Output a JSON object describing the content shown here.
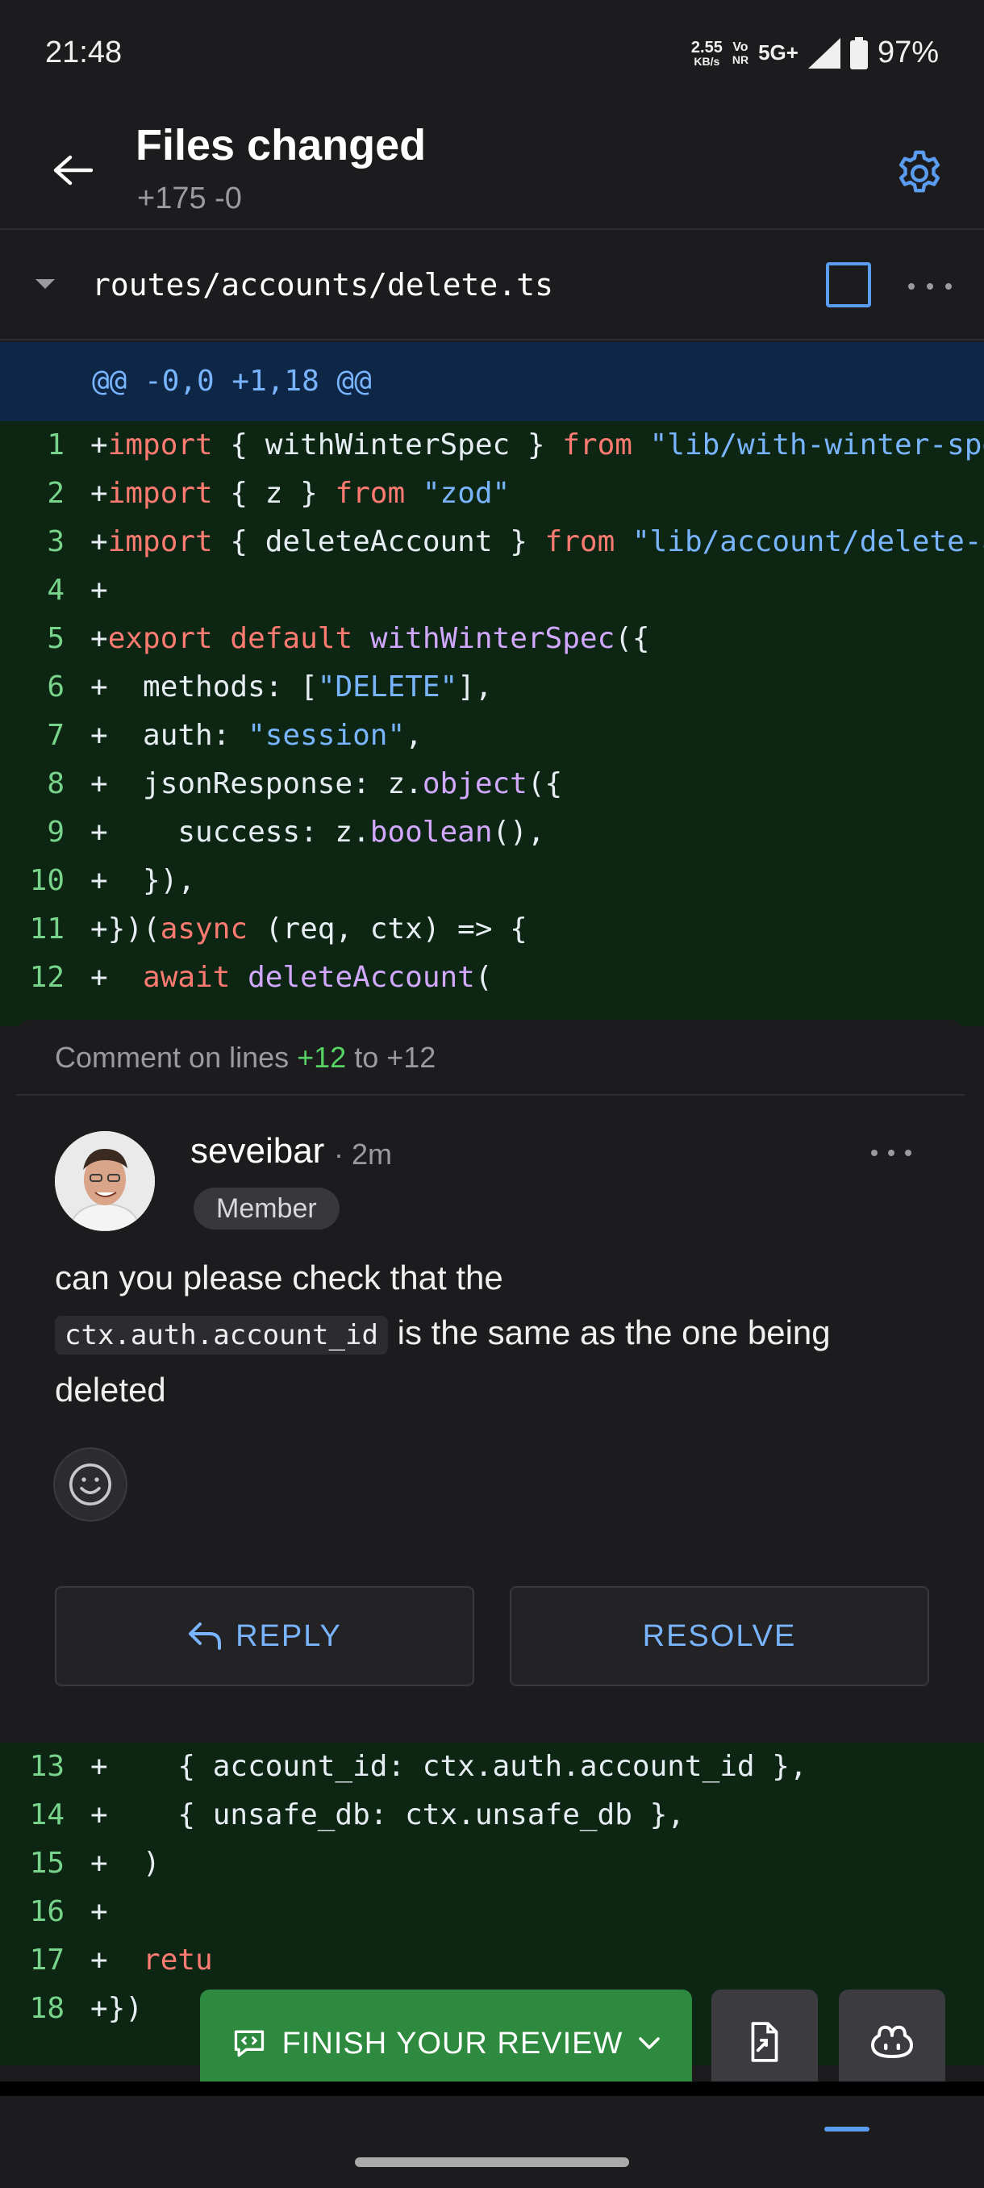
{
  "status_bar": {
    "time": "21:48",
    "speed_value": "2.55",
    "speed_unit": "KB/s",
    "volte_top": "Vo",
    "volte_bottom": "NR",
    "network": "5G+",
    "battery": "97%"
  },
  "header": {
    "title": "Files changed",
    "subtitle": "+175 -0"
  },
  "file": {
    "path": "routes/accounts/delete.ts",
    "hunk": "@@ -0,0 +1,18 @@"
  },
  "code_lines_top": [
    {
      "num": "1",
      "parts": [
        {
          "t": "+",
          "c": ""
        },
        {
          "t": "import",
          "c": "kw"
        },
        {
          "t": " { withWinterSpec } ",
          "c": ""
        },
        {
          "t": "from",
          "c": "kw"
        },
        {
          "t": " ",
          "c": ""
        },
        {
          "t": "\"lib/with-winter-spec\"",
          "c": "str"
        }
      ]
    },
    {
      "num": "2",
      "parts": [
        {
          "t": "+",
          "c": ""
        },
        {
          "t": "import",
          "c": "kw"
        },
        {
          "t": " { z } ",
          "c": ""
        },
        {
          "t": "from",
          "c": "kw"
        },
        {
          "t": " ",
          "c": ""
        },
        {
          "t": "\"zod\"",
          "c": "str"
        }
      ]
    },
    {
      "num": "3",
      "parts": [
        {
          "t": "+",
          "c": ""
        },
        {
          "t": "import",
          "c": "kw"
        },
        {
          "t": " { deleteAccount } ",
          "c": ""
        },
        {
          "t": "from",
          "c": "kw"
        },
        {
          "t": " ",
          "c": ""
        },
        {
          "t": "\"lib/account/delete-account\"",
          "c": "str"
        }
      ]
    },
    {
      "num": "4",
      "parts": [
        {
          "t": "+",
          "c": ""
        }
      ]
    },
    {
      "num": "5",
      "parts": [
        {
          "t": "+",
          "c": ""
        },
        {
          "t": "export default",
          "c": "kw"
        },
        {
          "t": " ",
          "c": ""
        },
        {
          "t": "withWinterSpec",
          "c": "fn"
        },
        {
          "t": "({",
          "c": ""
        }
      ]
    },
    {
      "num": "6",
      "parts": [
        {
          "t": "+  methods: [",
          "c": ""
        },
        {
          "t": "\"DELETE\"",
          "c": "str"
        },
        {
          "t": "],",
          "c": ""
        }
      ]
    },
    {
      "num": "7",
      "parts": [
        {
          "t": "+  auth: ",
          "c": ""
        },
        {
          "t": "\"session\"",
          "c": "str"
        },
        {
          "t": ",",
          "c": ""
        }
      ]
    },
    {
      "num": "8",
      "parts": [
        {
          "t": "+  jsonResponse: z.",
          "c": ""
        },
        {
          "t": "object",
          "c": "fn"
        },
        {
          "t": "({",
          "c": ""
        }
      ]
    },
    {
      "num": "9",
      "parts": [
        {
          "t": "+    success: z.",
          "c": ""
        },
        {
          "t": "boolean",
          "c": "fn"
        },
        {
          "t": "(),",
          "c": ""
        }
      ]
    },
    {
      "num": "10",
      "parts": [
        {
          "t": "+  }),",
          "c": ""
        }
      ]
    },
    {
      "num": "11",
      "parts": [
        {
          "t": "+})(",
          "c": ""
        },
        {
          "t": "async",
          "c": "kw"
        },
        {
          "t": " (req, ctx) => {",
          "c": ""
        }
      ]
    },
    {
      "num": "12",
      "parts": [
        {
          "t": "+  ",
          "c": ""
        },
        {
          "t": "await",
          "c": "kw"
        },
        {
          "t": " ",
          "c": ""
        },
        {
          "t": "deleteAccount",
          "c": "fn"
        },
        {
          "t": "(",
          "c": ""
        }
      ]
    }
  ],
  "code_lines_bottom": [
    {
      "num": "13",
      "parts": [
        {
          "t": "+    { account_id: ctx.auth.account_id },",
          "c": ""
        }
      ]
    },
    {
      "num": "14",
      "parts": [
        {
          "t": "+    { unsafe_db: ctx.unsafe_db },",
          "c": ""
        }
      ]
    },
    {
      "num": "15",
      "parts": [
        {
          "t": "+  )",
          "c": ""
        }
      ]
    },
    {
      "num": "16",
      "parts": [
        {
          "t": "+",
          "c": ""
        }
      ]
    },
    {
      "num": "17",
      "parts": [
        {
          "t": "+  ",
          "c": ""
        },
        {
          "t": "retu",
          "c": "kw"
        }
      ]
    },
    {
      "num": "18",
      "parts": [
        {
          "t": "+})",
          "c": ""
        }
      ]
    }
  ],
  "comment": {
    "lines_prefix": "Comment on lines ",
    "line_start": "+12",
    "lines_mid": " to ",
    "line_end": "+12",
    "author": "seveibar",
    "time": "· 2m",
    "role": "Member",
    "body_1": "can you please check that the",
    "body_code": "ctx.auth.account_id",
    "body_2": " is the same as the one being deleted",
    "reply_label": "REPLY",
    "resolve_label": "RESOLVE"
  },
  "bottom_bar": {
    "finish_label": "FINISH YOUR REVIEW"
  },
  "colors": {
    "accent": "#5a9cf0",
    "finish_green": "#2d8a3e",
    "added_bg": "#0c2613",
    "hunk_bg": "#0f2747"
  },
  "icons": [
    "back-arrow-icon",
    "gear-icon",
    "chevron-down-icon",
    "more-horizontal-icon",
    "smiley-icon",
    "reply-arrow-icon",
    "comment-review-icon",
    "file-diff-icon",
    "copilot-icon"
  ]
}
